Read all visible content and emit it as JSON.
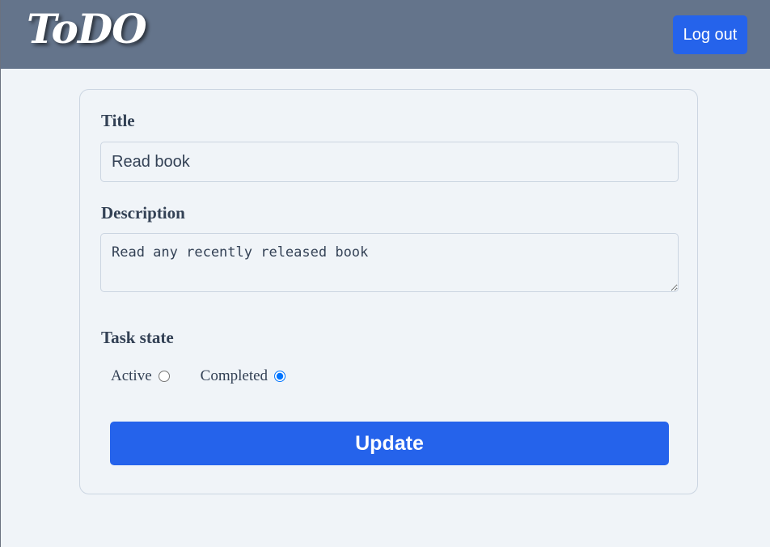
{
  "header": {
    "logo_text": "ToDO",
    "logout_label": "Log out",
    "background_color": "#64748b"
  },
  "form": {
    "title_label": "Title",
    "title_value": "Read book",
    "description_label": "Description",
    "description_value": "Read any recently released book",
    "task_state_label": "Task state",
    "options": [
      {
        "label": "Active",
        "selected": false
      },
      {
        "label": "Completed",
        "selected": true
      }
    ],
    "update_label": "Update"
  },
  "colors": {
    "accent": "#2563eb",
    "page_background": "#f0f4f8",
    "text": "#334155"
  }
}
